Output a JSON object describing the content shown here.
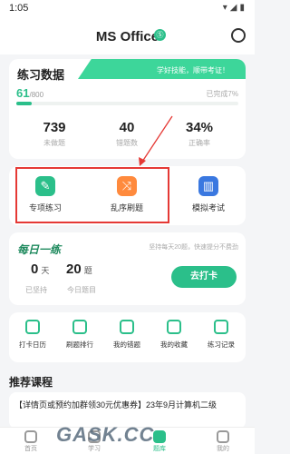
{
  "status_bar": {
    "time": "1:05",
    "icons": "▾◢▮"
  },
  "header": {
    "title": "MS Office",
    "badge": "Ⓢ"
  },
  "practice": {
    "title": "练习数据",
    "slogan": "学好技能，顺带考证！",
    "progress_current": "61",
    "progress_total": "/800",
    "done_text": "已完成7%",
    "progress_fraction": 0.07,
    "stats": [
      {
        "value": "739",
        "label": "未做题"
      },
      {
        "value": "40",
        "label": "错题数"
      },
      {
        "value": "34%",
        "label": "正确率"
      }
    ]
  },
  "modes": [
    {
      "label": "专项练习",
      "icon": "pencil-note-icon",
      "color": "#2bbf8a"
    },
    {
      "label": "乱序刷题",
      "icon": "shuffle-icon",
      "color": "#ff8a3d"
    },
    {
      "label": "模拟考试",
      "icon": "books-icon",
      "color": "#3a78e0"
    }
  ],
  "daily": {
    "title": "每日一练",
    "note": "坚持每天20题，快速提分不费劲",
    "days_value": "0",
    "days_unit": "天",
    "days_label": "已坚持",
    "today_value": "20",
    "today_unit": "题",
    "today_label": "今日题目",
    "button": "去打卡"
  },
  "tools": [
    {
      "label": "打卡日历",
      "icon": "calendar-icon"
    },
    {
      "label": "刷题排行",
      "icon": "trophy-icon"
    },
    {
      "label": "我的错题",
      "icon": "wrong-book-icon"
    },
    {
      "label": "我的收藏",
      "icon": "star-icon"
    },
    {
      "label": "练习记录",
      "icon": "record-icon"
    }
  ],
  "recommend": {
    "title": "推荐课程",
    "course_text": "【详情页或预约加群领30元优惠券】23年9月计算机二级"
  },
  "tabbar": [
    {
      "label": "首页"
    },
    {
      "label": "学习"
    },
    {
      "label": "题库"
    },
    {
      "label": "我的"
    }
  ],
  "watermark": "GASK.CC"
}
